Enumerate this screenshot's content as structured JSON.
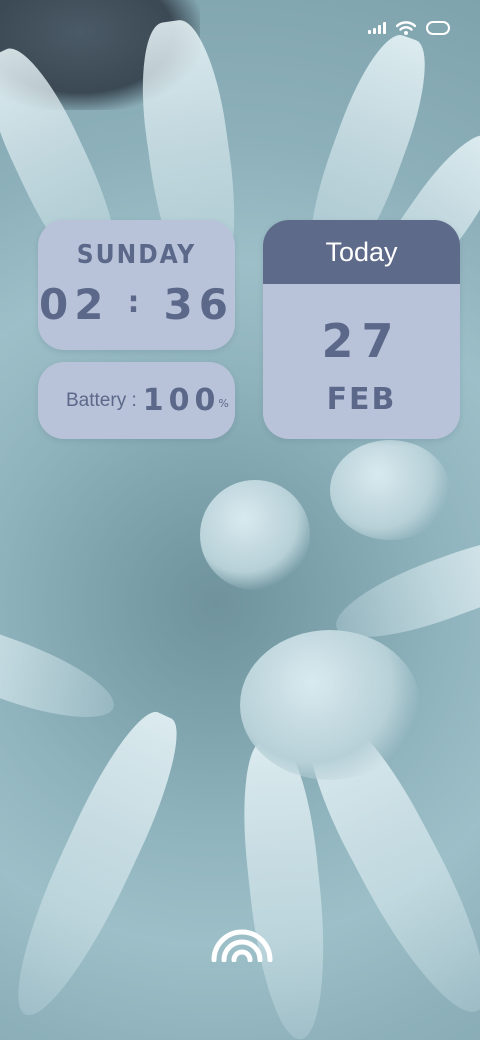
{
  "status_bar": {
    "signal_icon": "cellular-signal-icon",
    "wifi_icon": "wifi-icon",
    "battery_icon": "battery-icon"
  },
  "clock_widget": {
    "day": "SUNDAY",
    "hour": "02",
    "separator": ":",
    "minute": "36"
  },
  "battery_widget": {
    "label": "Battery :",
    "value": "100",
    "unit": "%"
  },
  "date_widget": {
    "header": "Today",
    "day_number": "27",
    "month": "FEB"
  },
  "unlock": {
    "icon": "fingerprint-unlock-icon"
  },
  "colors": {
    "widget_bg": "#b8c3d9",
    "widget_text": "#5c6889",
    "header_bg": "#5d6a89"
  }
}
